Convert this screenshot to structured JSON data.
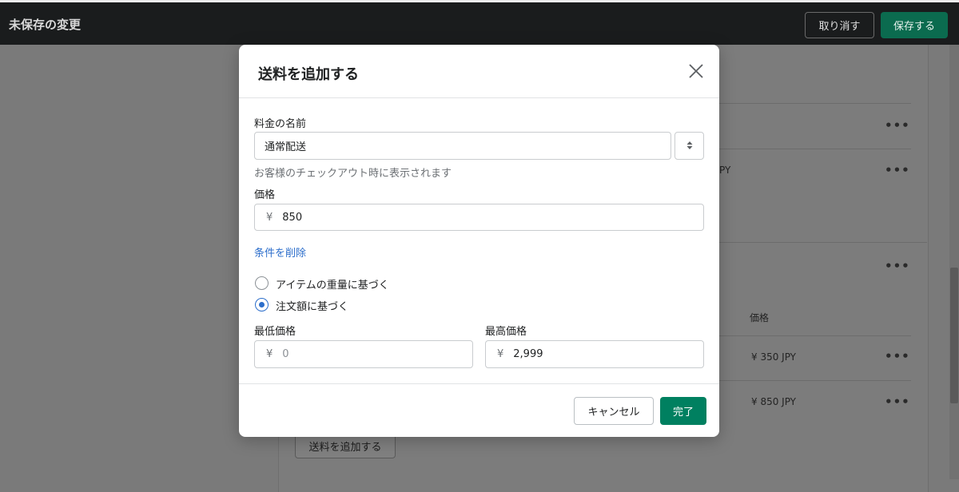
{
  "topbar": {
    "title": "未保存の変更",
    "discard_label": "取り消す",
    "save_label": "保存する"
  },
  "background": {
    "partial_price_text": "PY",
    "price_column_header": "価格",
    "row1_price": "¥ 350 JPY",
    "row2_price": "¥ 850 JPY",
    "add_rate_button": "送料を追加する",
    "more_icon": "•••"
  },
  "modal": {
    "title": "送料を追加する",
    "rate_name_label": "料金の名前",
    "rate_name_value": "通常配送",
    "rate_name_help": "お客様のチェックアウト時に表示されます",
    "price_label": "価格",
    "currency_symbol": "¥",
    "price_value": "850",
    "remove_conditions_link": "条件を削除",
    "condition_weight_label": "アイテムの重量に基づく",
    "condition_order_label": "注文額に基づく",
    "selected_condition": "注文額に基づく",
    "min_price_label": "最低価格",
    "min_price_placeholder": "0",
    "max_price_label": "最高価格",
    "max_price_value": "2,999",
    "cancel_label": "キャンセル",
    "done_label": "完了"
  },
  "colors": {
    "primary_green": "#008060",
    "link_blue": "#2c6ecb",
    "topbar_bg": "#1a1c1d"
  }
}
